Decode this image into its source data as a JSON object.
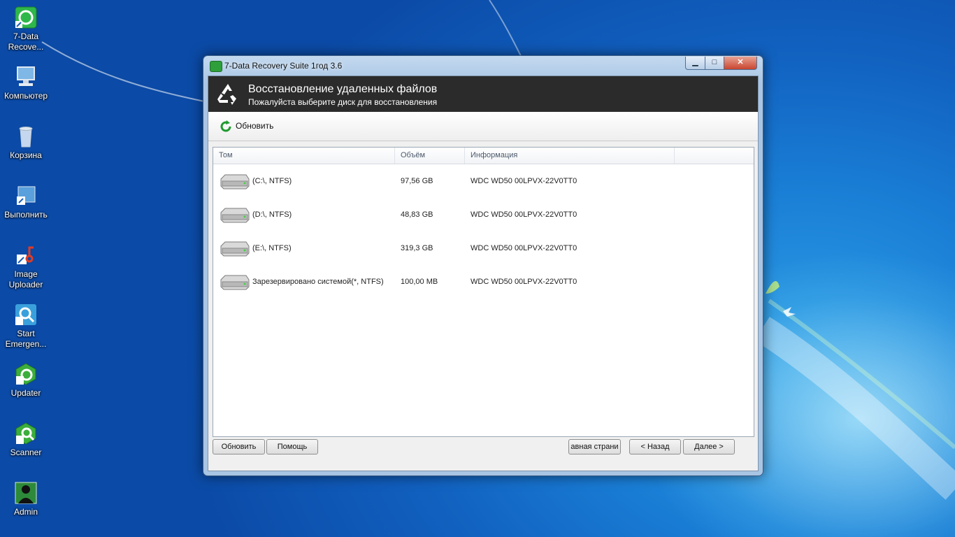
{
  "desktop": {
    "icons": [
      {
        "label": "7-Data\nRecove...",
        "icon": "seven-data-icon"
      },
      {
        "label": "Компьютер",
        "icon": "computer-icon"
      },
      {
        "label": "Корзина",
        "icon": "recycle-bin-icon"
      },
      {
        "label": "Выполнить",
        "icon": "run-icon"
      },
      {
        "label": "Image\nUploader",
        "icon": "image-uploader-icon"
      },
      {
        "label": "Start\nEmergen...",
        "icon": "emergency-icon"
      },
      {
        "label": "Updater",
        "icon": "updater-icon"
      },
      {
        "label": "Scanner",
        "icon": "scanner-icon"
      },
      {
        "label": "Admin",
        "icon": "admin-icon"
      }
    ]
  },
  "window": {
    "title": "7-Data Recovery Suite 1год 3.6",
    "controls": {
      "minimize": "▁",
      "maximize": "□",
      "close": "✕"
    }
  },
  "header": {
    "title": "Восстановление удаленных файлов",
    "subtitle": "Пожалуйста выберите диск для восстановления"
  },
  "toolbar": {
    "refresh_label": "Обновить"
  },
  "list": {
    "columns": [
      "Том",
      "Объём",
      "Информация"
    ],
    "rows": [
      {
        "volume": "(C:\\, NTFS)",
        "size": "97,56 GB",
        "info": "WDC WD50 00LPVX-22V0TT0"
      },
      {
        "volume": "(D:\\, NTFS)",
        "size": "48,83 GB",
        "info": "WDC WD50 00LPVX-22V0TT0"
      },
      {
        "volume": "(E:\\, NTFS)",
        "size": "319,3 GB",
        "info": "WDC WD50 00LPVX-22V0TT0"
      },
      {
        "volume": "Зарезервировано системой(*, NTFS)",
        "size": "100,00 MB",
        "info": "WDC WD50 00LPVX-22V0TT0"
      }
    ]
  },
  "footer": {
    "refresh": "Обновить",
    "help": "Помощь",
    "home": "авная страни",
    "back": "< Назад",
    "next": "Далее >"
  },
  "colors": {
    "header_bg": "#2b2b2b",
    "accent_green": "#2e9f3b"
  }
}
